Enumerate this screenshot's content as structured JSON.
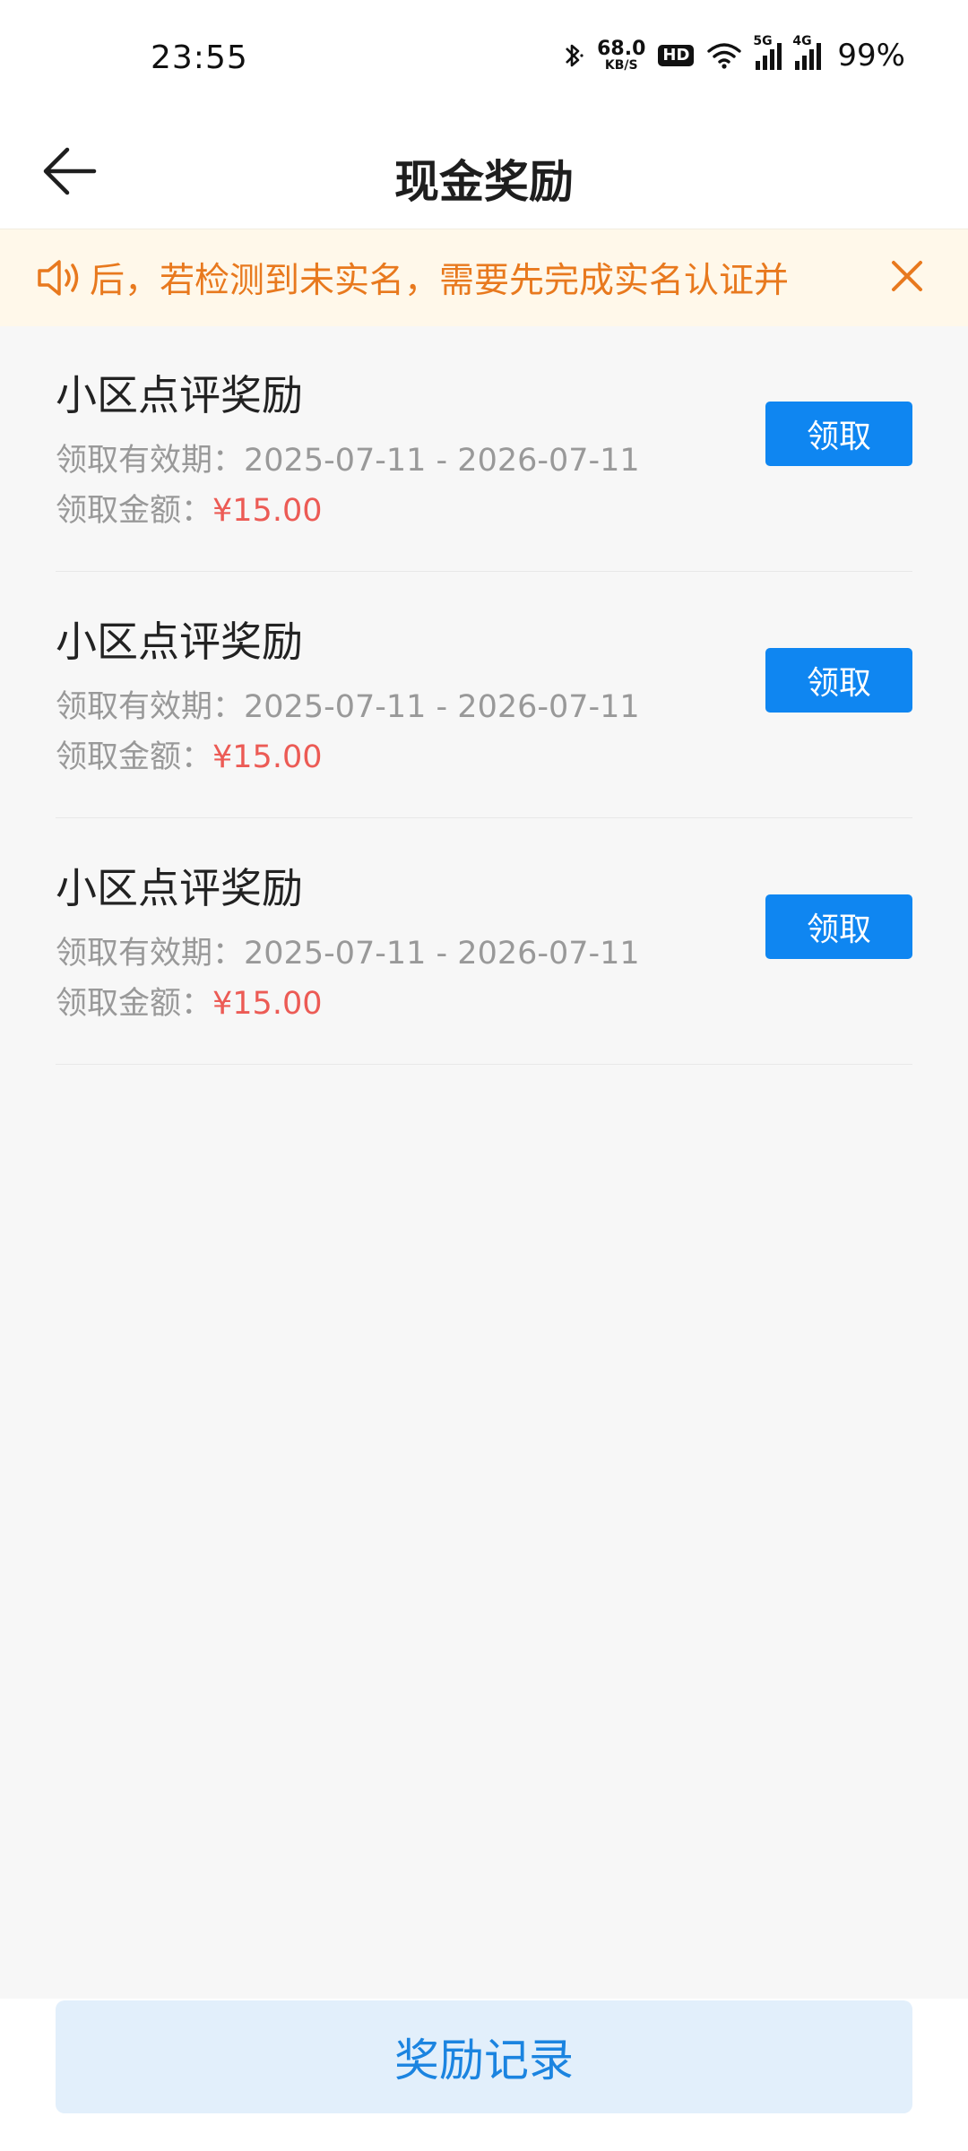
{
  "status_bar": {
    "time": "23:55",
    "net_speed_value": "68.0",
    "net_speed_unit": "KB/S",
    "hd_badge": "HD",
    "signal1_label": "5G",
    "signal2_label": "4G",
    "battery": "99%"
  },
  "nav": {
    "title": "现金奖励",
    "back_icon": "arrow-left-icon"
  },
  "notice": {
    "icon": "speaker-icon",
    "text": "后，若检测到未实名，需要先完成实名认证并",
    "close_icon": "close-icon"
  },
  "rewards": [
    {
      "title": "小区点评奖励",
      "validity_label": "领取有效期：",
      "validity_range": "2025-07-11 - 2026-07-11",
      "amount_label": "领取金额：",
      "amount": "¥15.00",
      "button": "领取"
    },
    {
      "title": "小区点评奖励",
      "validity_label": "领取有效期：",
      "validity_range": "2025-07-11 - 2026-07-11",
      "amount_label": "领取金额：",
      "amount": "¥15.00",
      "button": "领取"
    },
    {
      "title": "小区点评奖励",
      "validity_label": "领取有效期：",
      "validity_range": "2025-07-11 - 2026-07-11",
      "amount_label": "领取金额：",
      "amount": "¥15.00",
      "button": "领取"
    }
  ],
  "bottom": {
    "records_button": "奖励记录"
  },
  "colors": {
    "accent": "#0f86f1",
    "notice_text": "#e8791e",
    "notice_bg": "#fff8ea",
    "amount": "#ec5b55",
    "records_bg": "#e2effb",
    "records_text": "#1b84e0"
  }
}
